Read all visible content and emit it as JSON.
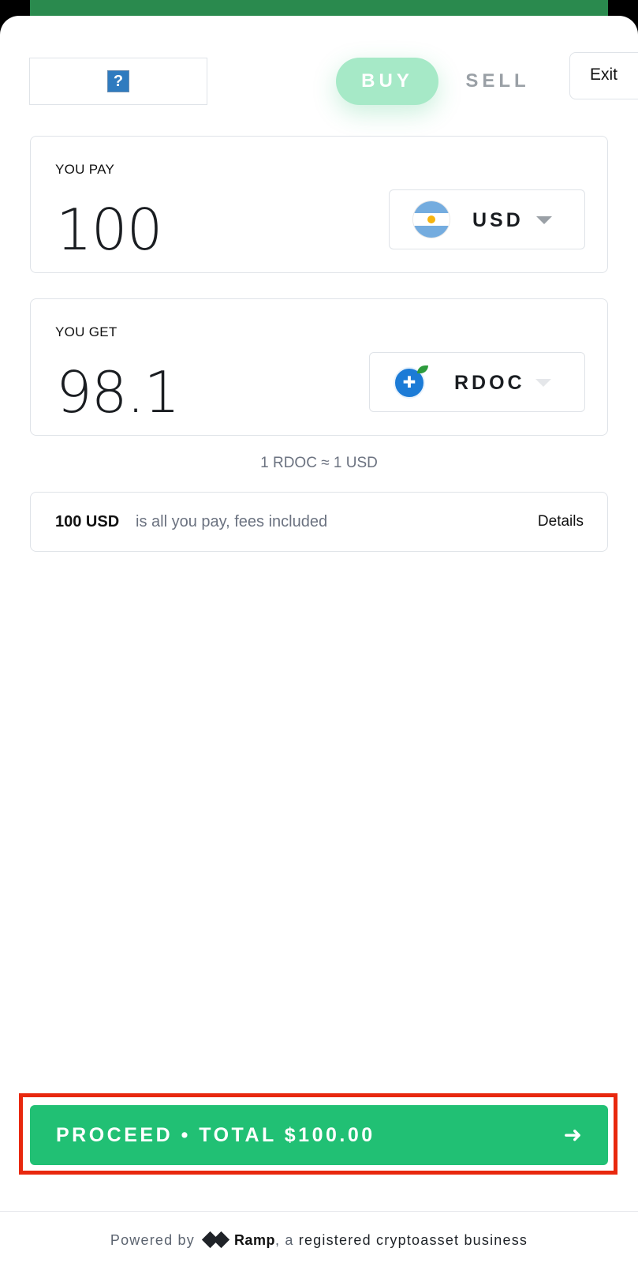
{
  "tabs": {
    "buy": "BUY",
    "sell": "SELL"
  },
  "header": {
    "exit_label": "Exit",
    "logo_placeholder": "?"
  },
  "pay": {
    "label": "YOU PAY",
    "amount": "100",
    "currency": "USD",
    "currency_icon": "argentina-flag-icon"
  },
  "get": {
    "label": "YOU GET",
    "amount": "98.1",
    "currency": "RDOC",
    "currency_icon": "rdoc-token-icon"
  },
  "rate": "1 RDOC ≈ 1 USD",
  "fees": {
    "amount": "100 USD",
    "text": "is all you pay, fees included",
    "details_label": "Details"
  },
  "proceed": {
    "label": "PROCEED • TOTAL $100.00",
    "icon": "arrow-right-icon"
  },
  "footer": {
    "powered_by": "Powered by",
    "brand": "Ramp",
    "suffix": ", a",
    "business": "registered cryptoasset business"
  },
  "colors": {
    "accent": "#21c074",
    "buy_pill": "#a6e9c7",
    "highlight": "#e8280e",
    "top_bar": "#2a8a4e"
  }
}
